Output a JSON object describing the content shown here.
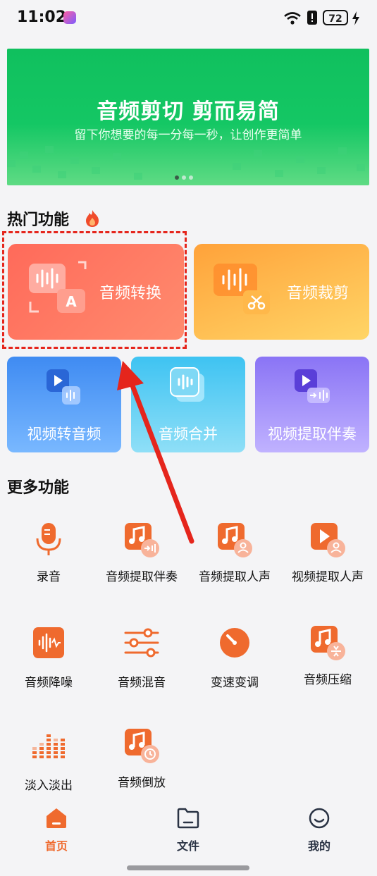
{
  "status_bar": {
    "time": "11:02",
    "battery": "72"
  },
  "banner": {
    "title": "音频剪切 剪而易简",
    "subtitle": "留下你想要的每一分每一秒，让创作更简单"
  },
  "hot": {
    "title": "热门功能",
    "cards": [
      {
        "label": "音频转换"
      },
      {
        "label": "音频裁剪"
      },
      {
        "label": "视频转音频"
      },
      {
        "label": "音频合并"
      },
      {
        "label": "视频提取伴奏"
      }
    ]
  },
  "more": {
    "title": "更多功能",
    "items": [
      {
        "label": "录音",
        "icon": "microphone-icon"
      },
      {
        "label": "音频提取伴奏",
        "icon": "music-extract-icon"
      },
      {
        "label": "音频提取人声",
        "icon": "music-vocal-icon"
      },
      {
        "label": "视频提取人声",
        "icon": "video-vocal-icon"
      },
      {
        "label": "音频降噪",
        "icon": "denoise-icon"
      },
      {
        "label": "音频混音",
        "icon": "mixer-icon"
      },
      {
        "label": "变速变调",
        "icon": "speed-dial-icon"
      },
      {
        "label": "音频压缩",
        "icon": "compress-icon"
      },
      {
        "label": "淡入淡出",
        "icon": "fade-icon"
      },
      {
        "label": "音频倒放",
        "icon": "reverse-icon"
      }
    ]
  },
  "nav": {
    "items": [
      {
        "label": "首页",
        "icon": "home-icon"
      },
      {
        "label": "文件",
        "icon": "folder-icon"
      },
      {
        "label": "我的",
        "icon": "smile-icon"
      }
    ],
    "active_color": "#ef6a2e"
  },
  "colors": {
    "accent": "#ef6a2e",
    "banner_green": "#14c764",
    "highlight_red": "#e5251c"
  }
}
